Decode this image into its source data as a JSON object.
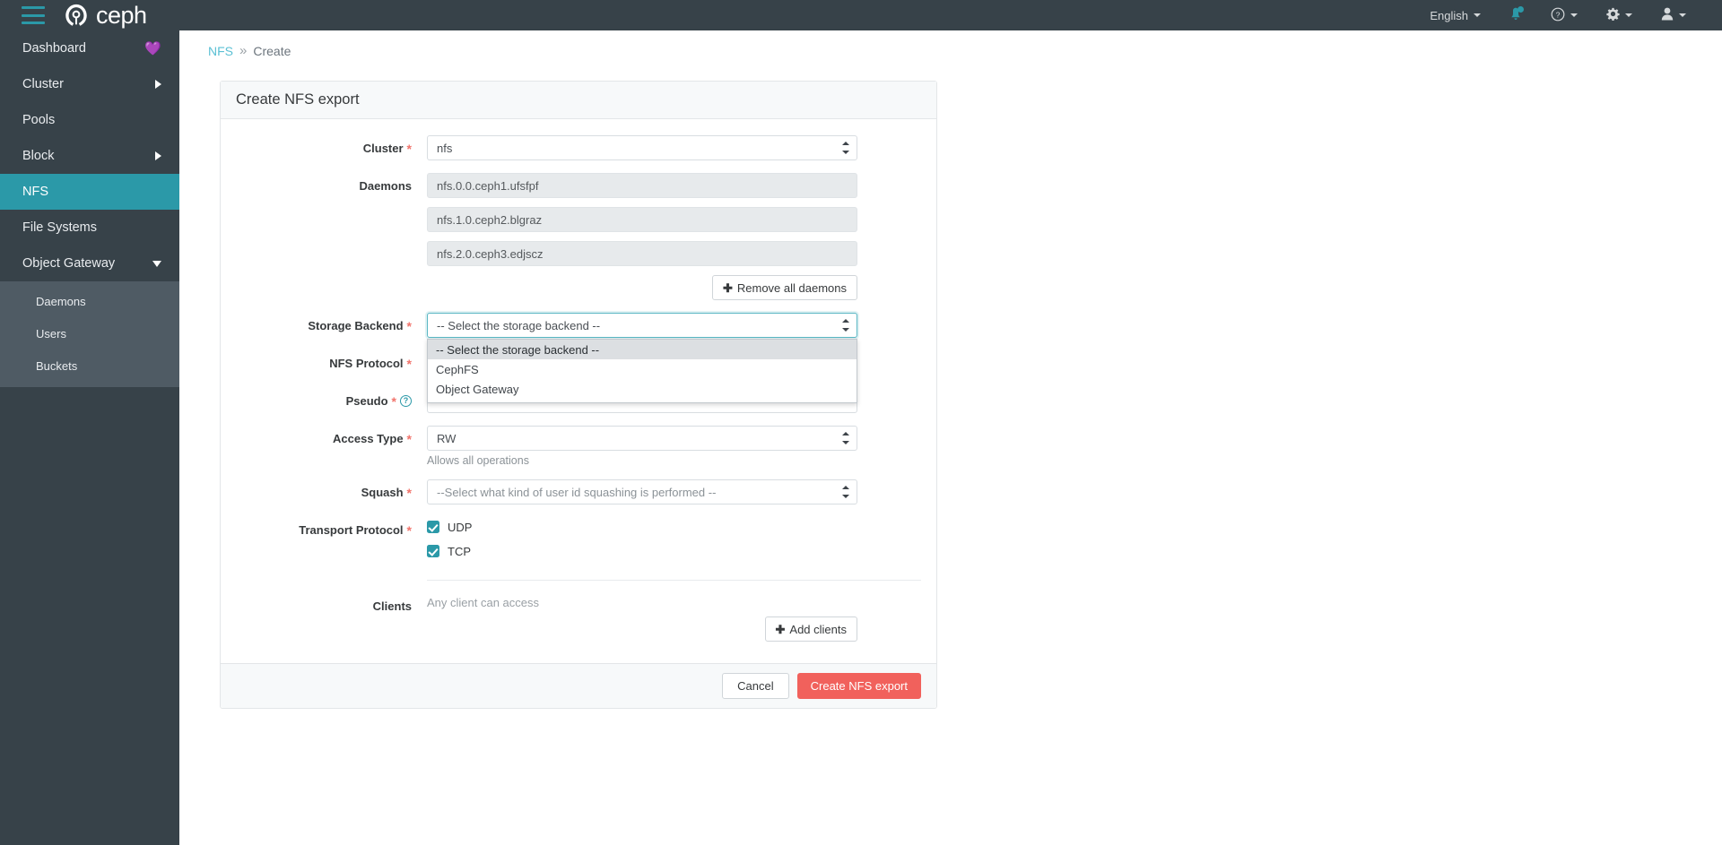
{
  "topnav": {
    "brand": "ceph",
    "menu_icon": "hamburger-icon",
    "language": "English",
    "icons": {
      "notifications": "bell-icon",
      "help": "question-circle-icon",
      "settings": "gear-icon",
      "user": "user-icon"
    }
  },
  "sidebar": {
    "items": [
      {
        "label": "Dashboard",
        "icon": "heartbeat-icon",
        "state": "default"
      },
      {
        "label": "Cluster",
        "icon": "chevron-right-icon",
        "state": "default"
      },
      {
        "label": "Pools",
        "icon": "",
        "state": "default"
      },
      {
        "label": "Block",
        "icon": "chevron-right-icon",
        "state": "default"
      },
      {
        "label": "NFS",
        "icon": "",
        "state": "active"
      },
      {
        "label": "File Systems",
        "icon": "",
        "state": "default"
      },
      {
        "label": "Object Gateway",
        "icon": "chevron-down-icon",
        "state": "expanded"
      }
    ],
    "submenu": [
      {
        "label": "Daemons"
      },
      {
        "label": "Users"
      },
      {
        "label": "Buckets"
      }
    ]
  },
  "breadcrumb": {
    "root": "NFS",
    "separator": "»",
    "current": "Create"
  },
  "card": {
    "title": "Create NFS export"
  },
  "form": {
    "cluster": {
      "label": "Cluster",
      "required": true,
      "value": "nfs"
    },
    "daemons": {
      "label": "Daemons",
      "required": false,
      "values": [
        "nfs.0.0.ceph1.ufsfpf",
        "nfs.1.0.ceph2.blgraz",
        "nfs.2.0.ceph3.edjscz"
      ],
      "remove_button": "Remove all daemons"
    },
    "storage_backend": {
      "label": "Storage Backend",
      "required": true,
      "value": "-- Select the storage backend --",
      "open": true,
      "options": [
        "-- Select the storage backend --",
        "CephFS",
        "Object Gateway"
      ],
      "selected_index": 0
    },
    "nfs_protocol": {
      "label": "NFS Protocol",
      "required": true,
      "value": ""
    },
    "pseudo": {
      "label": "Pseudo",
      "required": true,
      "value": "",
      "help_icon": "question-circle-icon"
    },
    "access_type": {
      "label": "Access Type",
      "required": true,
      "value": "RW",
      "helper_text": "Allows all operations"
    },
    "squash": {
      "label": "Squash",
      "required": true,
      "value": "--Select what kind of user id squashing is performed --"
    },
    "transport_protocol": {
      "label": "Transport Protocol",
      "required": true,
      "options": [
        {
          "label": "UDP",
          "checked": true
        },
        {
          "label": "TCP",
          "checked": true
        }
      ]
    },
    "clients": {
      "label": "Clients",
      "required": false,
      "text": "Any client can access",
      "add_button": "Add clients"
    }
  },
  "footer": {
    "cancel": "Cancel",
    "submit": "Create NFS export"
  },
  "colors": {
    "navbar": "#374249",
    "accent_teal": "#2b99a8",
    "primary_red": "#f1615c",
    "required_red": "#f1746c",
    "link_teal": "#5bc0d4"
  }
}
